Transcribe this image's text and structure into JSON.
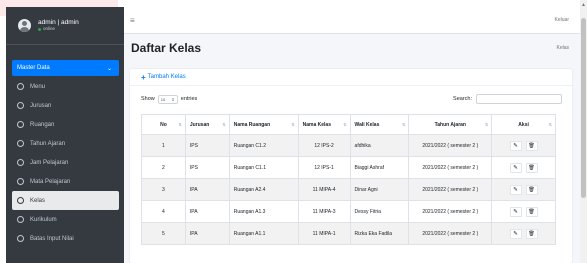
{
  "user": {
    "name": "admin | admin",
    "status": "online"
  },
  "sidebar": {
    "master_label": "Master Data",
    "items": [
      {
        "label": "Menu"
      },
      {
        "label": "Jurusan"
      },
      {
        "label": "Ruangan"
      },
      {
        "label": "Tahun Ajaran"
      },
      {
        "label": "Jam Pelajaran"
      },
      {
        "label": "Mata Pelajaran"
      },
      {
        "label": "Kelas"
      },
      {
        "label": "Kurikulum"
      },
      {
        "label": "Batas Input Nilai"
      }
    ]
  },
  "topbar": {
    "menu_icon": "≡",
    "logout": "Keluar"
  },
  "page": {
    "title": "Daftar Kelas",
    "breadcrumb": "Kelas"
  },
  "card": {
    "add_label": "Tambah Kelas"
  },
  "controls": {
    "show_label": "Show",
    "length": "10",
    "entries_label": "entries",
    "search_label": "Search:"
  },
  "table": {
    "headers": [
      "No",
      "Jurusan",
      "Nama Ruangan",
      "Nama Kelas",
      "Wali Kelas",
      "Tahun Ajaran",
      "Aksi"
    ],
    "rows": [
      {
        "no": "1",
        "jurusan": "IPS",
        "ruangan": "Ruangan C1.2",
        "kelas": "12 IPS-2",
        "wali": "afdhika",
        "tahun": "2021/2022 ( semester 2 )"
      },
      {
        "no": "2",
        "jurusan": "IPS",
        "ruangan": "Ruangan C1.1",
        "kelas": "12 IPS-1",
        "wali": "Biaggi Ashraf",
        "tahun": "2021/2022 ( semester 2 )"
      },
      {
        "no": "3",
        "jurusan": "IPA",
        "ruangan": "Ruangan A2.4",
        "kelas": "11 MIPA-4",
        "wali": "Dinar Agni",
        "tahun": "2021/2022 ( semester 2 )"
      },
      {
        "no": "4",
        "jurusan": "IPA",
        "ruangan": "Ruangan A1.3",
        "kelas": "11 MIPA-3",
        "wali": "Dessy Fitria",
        "tahun": "2021/2022 ( semester 2 )"
      },
      {
        "no": "5",
        "jurusan": "IPA",
        "ruangan": "Ruangan A1.1",
        "kelas": "11 MIPA-1",
        "wali": "Rizka Eka Fadila",
        "tahun": "2021/2022 ( semester 2 )"
      }
    ]
  },
  "colors": {
    "sidebar_bg": "#343a40",
    "accent": "#007bff",
    "content_bg": "#f4f6f9",
    "online": "#28a745"
  },
  "icons": {
    "avatar": "user-avatar-icon",
    "edit": "edit-icon",
    "delete": "trash-icon",
    "menu": "hamburger-icon"
  }
}
